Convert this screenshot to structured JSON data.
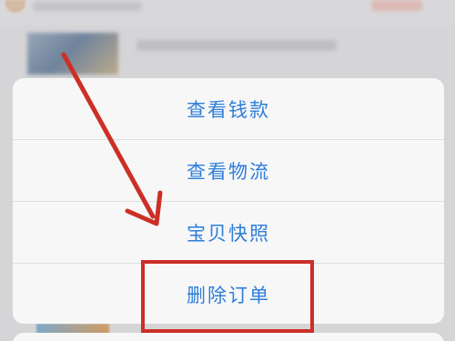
{
  "action_sheet": {
    "options": [
      {
        "label": "查看钱款"
      },
      {
        "label": "查看物流"
      },
      {
        "label": "宝贝快照"
      },
      {
        "label": "删除订单"
      }
    ]
  },
  "annotation": {
    "color": "#cc2f26",
    "highlighted_option": "删除订单"
  },
  "colors": {
    "option_text": "#2f7ed8",
    "sheet_background": "#f7f7f8"
  }
}
